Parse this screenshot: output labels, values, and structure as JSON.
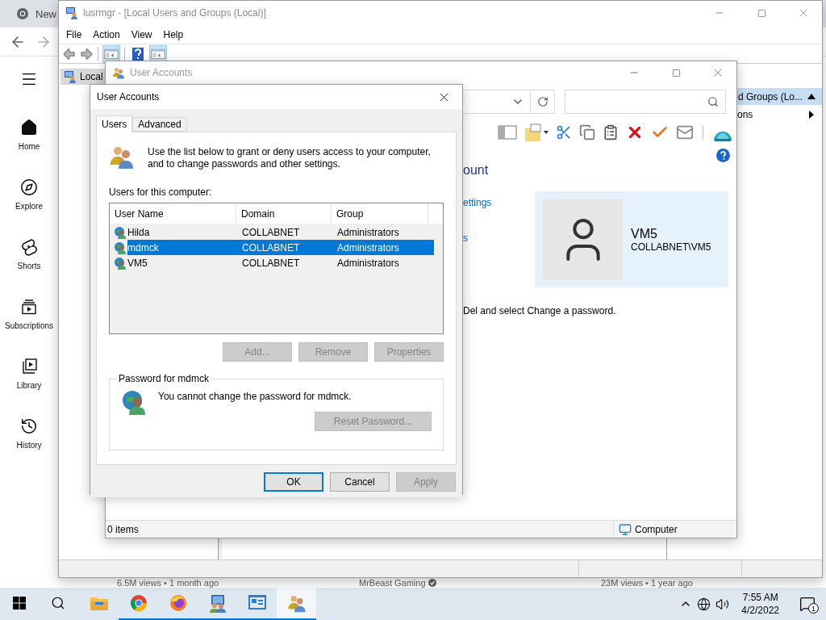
{
  "browser": {
    "tab": "New",
    "sidebar": [
      {
        "kind": "home",
        "label": "Home"
      },
      {
        "kind": "explore",
        "label": "Explore"
      },
      {
        "kind": "shorts",
        "label": "Shorts"
      },
      {
        "kind": "subscriptions",
        "label": "Subscriptions"
      },
      {
        "kind": "library",
        "label": "Library"
      },
      {
        "kind": "history",
        "label": "History"
      }
    ],
    "video_meta": [
      {
        "text": "6.5M views • 1 month ago",
        "verified": false
      },
      {
        "text": "MrBeast Gaming",
        "verified": true
      },
      {
        "text": "23M views • 1 year ago",
        "verified": false
      }
    ]
  },
  "mmc": {
    "title": "lusrmgr - [Local Users and Groups (Local)]",
    "menu": [
      "File",
      "Action",
      "View",
      "Help"
    ],
    "tree": [
      {
        "label": "Local",
        "selected": true
      }
    ],
    "actions": {
      "header": "d Groups (Lo...",
      "items": [
        "ons"
      ]
    }
  },
  "control_panel": {
    "title": "User Accounts",
    "heading": "ount",
    "links": [
      "ettings",
      "s"
    ],
    "account": {
      "name": "VM5",
      "domain_name": "COLLABNET\\VM5"
    },
    "note": "Del and select Change a password.",
    "status": {
      "count": "0 items",
      "zone": "Computer"
    }
  },
  "dialog": {
    "title": "User Accounts",
    "tabs": [
      {
        "label": "Users",
        "selected": true
      },
      {
        "label": "Advanced",
        "selected": false
      }
    ],
    "intro": "Use the list below to grant or deny users access to your computer, and to change passwords and other settings.",
    "list_label": "Users for this computer:",
    "table": {
      "columns": [
        "User Name",
        "Domain",
        "Group"
      ],
      "rows": [
        {
          "cells": [
            "Hilda",
            "COLLABNET",
            "Administrators"
          ],
          "selected": false
        },
        {
          "cells": [
            "mdmck",
            "COLLABNET",
            "Administrators"
          ],
          "selected": true
        },
        {
          "cells": [
            "VM5",
            "COLLABNET",
            "Administrators"
          ],
          "selected": false
        }
      ]
    },
    "list_buttons": [
      {
        "label": "Add...",
        "disabled": true
      },
      {
        "label": "Remove",
        "disabled": true
      },
      {
        "label": "Properties",
        "disabled": true
      }
    ],
    "password": {
      "legend": "Password for mdmck",
      "message": "You cannot change the password for mdmck.",
      "button": {
        "label": "Reset Password...",
        "disabled": true
      }
    },
    "buttons": [
      {
        "label": "OK",
        "disabled": false,
        "focused": true
      },
      {
        "label": "Cancel",
        "disabled": false,
        "focused": false
      },
      {
        "label": "Apply",
        "disabled": true,
        "focused": false
      }
    ]
  },
  "taskbar": {
    "apps": [
      {
        "kind": "explorer",
        "running": false,
        "selected": false
      },
      {
        "kind": "chrome",
        "running": true,
        "selected": false
      },
      {
        "kind": "firefox",
        "running": true,
        "selected": false
      },
      {
        "kind": "mmc",
        "running": true,
        "selected": false
      },
      {
        "kind": "control-panel",
        "running": true,
        "selected": false
      },
      {
        "kind": "user-accounts",
        "running": true,
        "selected": true
      }
    ],
    "time": "7:55 AM",
    "date": "4/2/2022",
    "notifications": "1"
  }
}
